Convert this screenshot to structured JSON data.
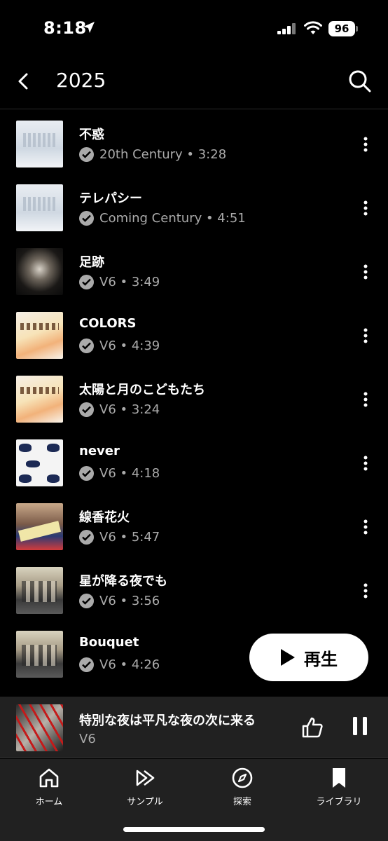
{
  "status_bar": {
    "time": "8:18",
    "battery": "96"
  },
  "header": {
    "title": "2025"
  },
  "songs": [
    {
      "title": "不惑",
      "meta": "20th Century • 3:28"
    },
    {
      "title": "テレパシー",
      "meta": "Coming Century • 4:51"
    },
    {
      "title": "足跡",
      "meta": "V6 • 3:49"
    },
    {
      "title": "COLORS",
      "meta": "V6 • 4:39"
    },
    {
      "title": "太陽と月のこどもたち",
      "meta": "V6 • 3:24"
    },
    {
      "title": "never",
      "meta": "V6 • 4:18"
    },
    {
      "title": "線香花火",
      "meta": "V6 • 5:47"
    },
    {
      "title": "星が降る夜でも",
      "meta": "V6 • 3:56"
    },
    {
      "title": "Bouquet",
      "meta": "V6 • 4:26"
    }
  ],
  "play_button": {
    "label": "再生"
  },
  "now_playing": {
    "title": "特別な夜は平凡な夜の次に来る",
    "artist": "V6"
  },
  "nav": [
    {
      "label": "ホーム",
      "icon": "home-icon"
    },
    {
      "label": "サンプル",
      "icon": "samples-icon"
    },
    {
      "label": "探索",
      "icon": "explore-icon"
    },
    {
      "label": "ライブラリ",
      "icon": "library-icon"
    }
  ],
  "colors": {
    "background": "#000000",
    "panel": "#212121",
    "secondary_text": "#aaaaaa",
    "accent": "#ffffff"
  }
}
